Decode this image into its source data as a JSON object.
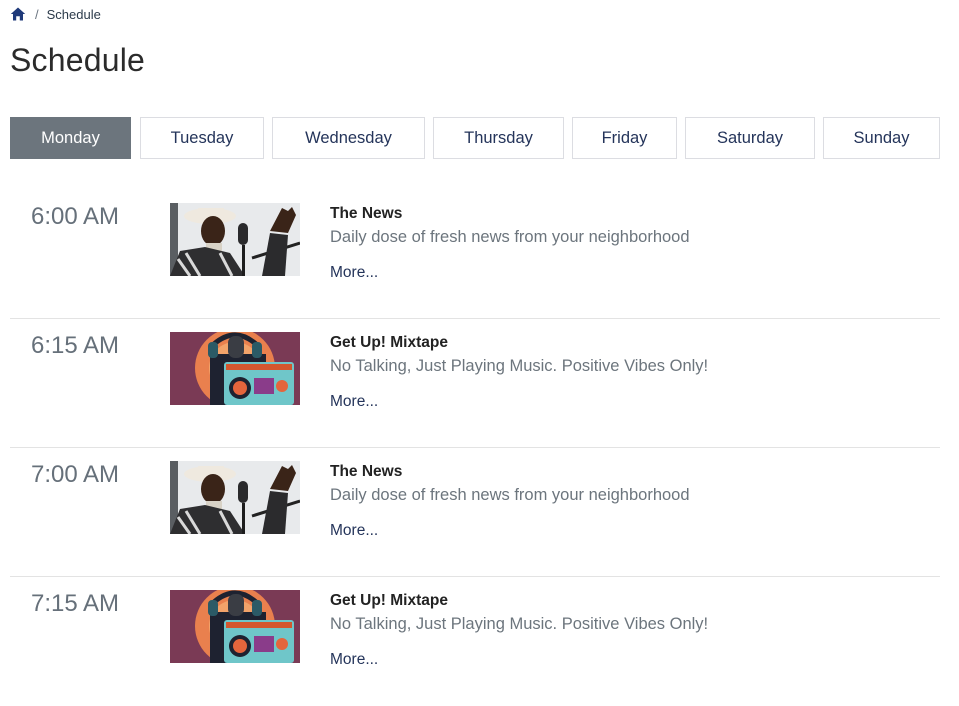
{
  "breadcrumb": {
    "home_icon": "home-icon",
    "separator": "/",
    "current": "Schedule"
  },
  "page": {
    "title": "Schedule"
  },
  "tabs": [
    {
      "label": "Monday",
      "active": true
    },
    {
      "label": "Tuesday",
      "active": false
    },
    {
      "label": "Wednesday",
      "active": false
    },
    {
      "label": "Thursday",
      "active": false
    },
    {
      "label": "Friday",
      "active": false
    },
    {
      "label": "Saturday",
      "active": false
    },
    {
      "label": "Sunday",
      "active": false
    }
  ],
  "schedule": [
    {
      "time": "6:00 AM",
      "image": "news-host-photo",
      "title": "The News",
      "description": "Daily dose of fresh news from your neighborhood",
      "more_label": "More..."
    },
    {
      "time": "6:15 AM",
      "image": "mixtape-boombox-art",
      "title": "Get Up! Mixtape",
      "description": "No Talking, Just Playing Music. Positive Vibes Only!",
      "more_label": "More..."
    },
    {
      "time": "7:00 AM",
      "image": "news-host-photo",
      "title": "The News",
      "description": "Daily dose of fresh news from your neighborhood",
      "more_label": "More..."
    },
    {
      "time": "7:15 AM",
      "image": "mixtape-boombox-art",
      "title": "Get Up! Mixtape",
      "description": "No Talking, Just Playing Music. Positive Vibes Only!",
      "more_label": "More..."
    }
  ],
  "colors": {
    "active_tab": "#6c757d",
    "link": "#24345a",
    "home_icon": "#1f3a7a"
  }
}
